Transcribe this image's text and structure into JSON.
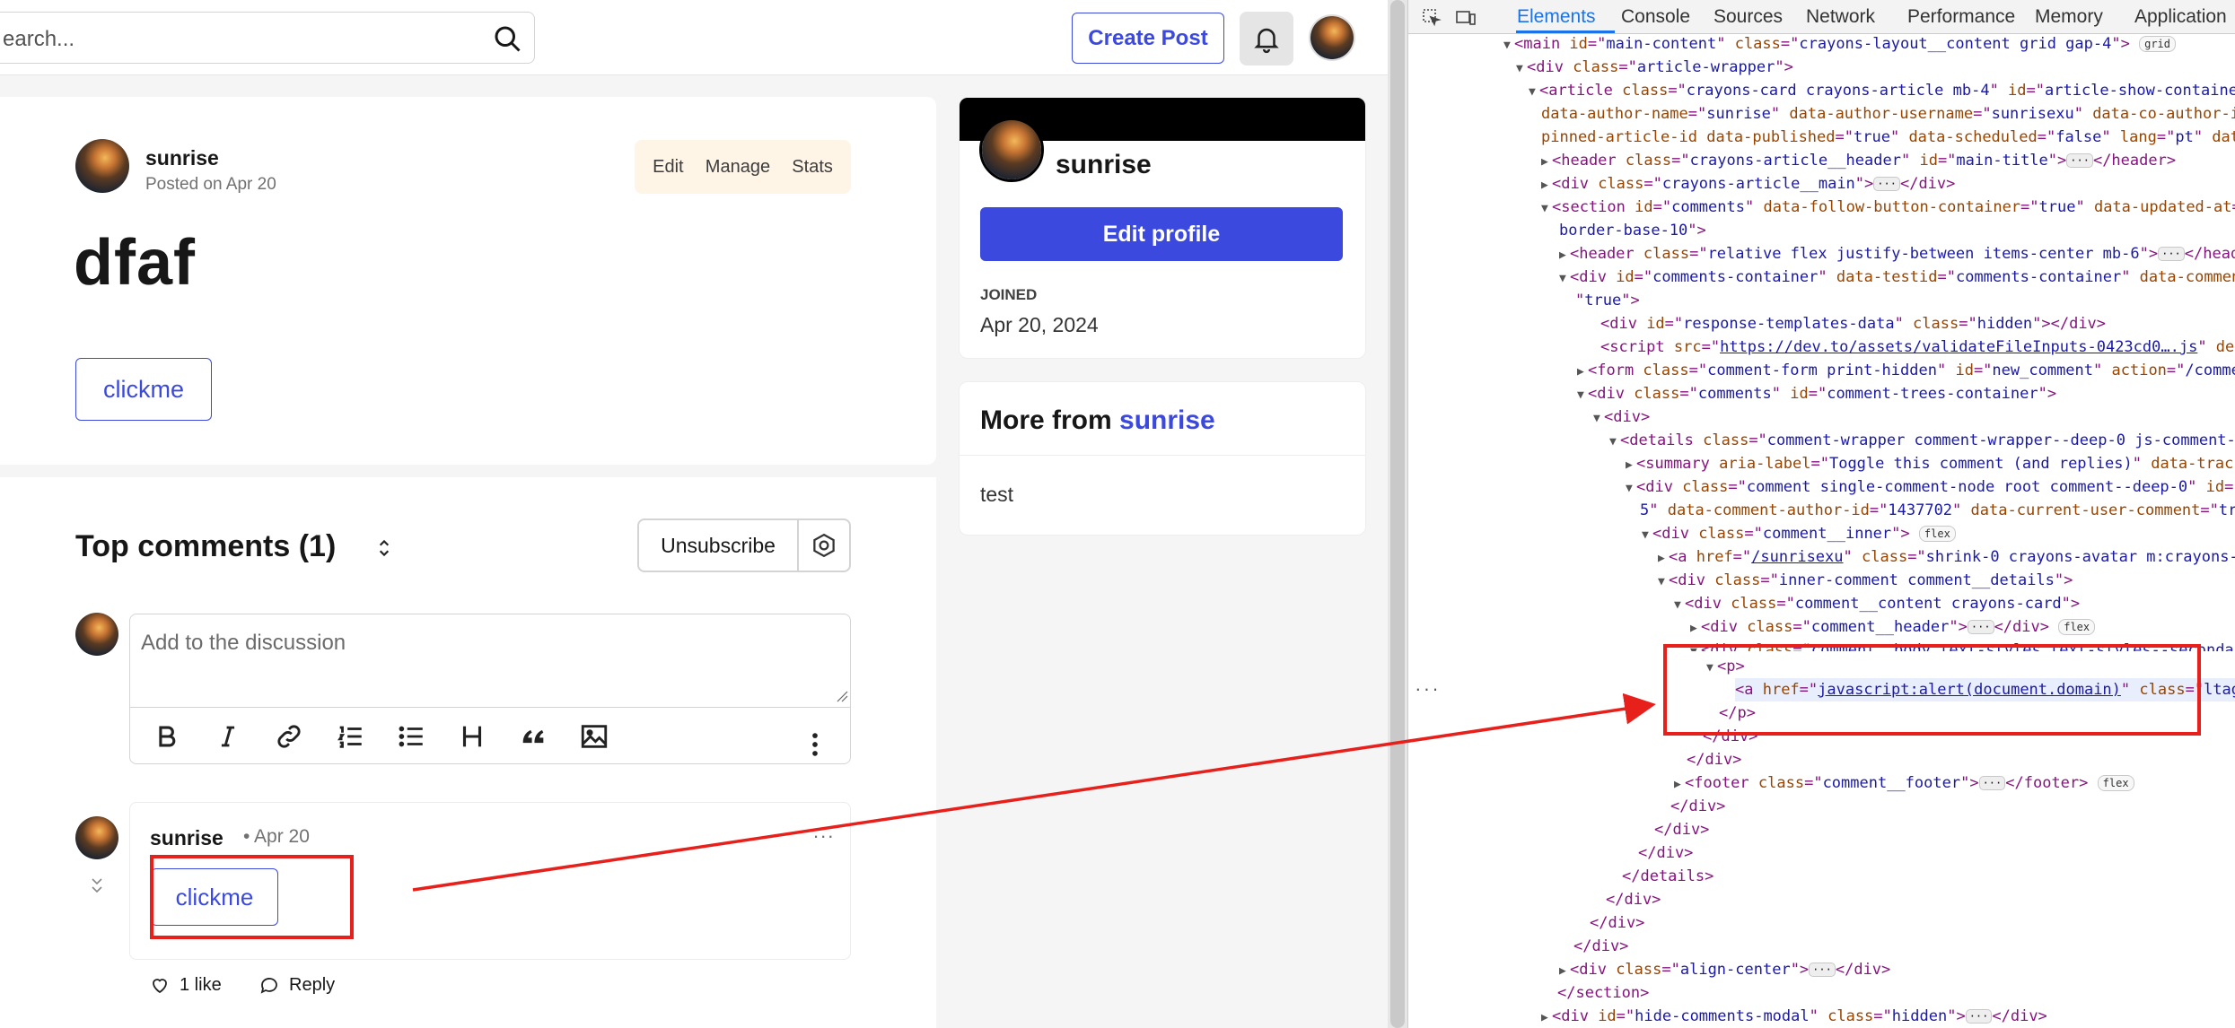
{
  "page": {
    "search": {
      "placeholder": "earch..."
    },
    "create_post": "Create Post",
    "article": {
      "author": "sunrise",
      "posted": "Posted on Apr 20",
      "actions": [
        "Edit",
        "Manage",
        "Stats"
      ],
      "title": "dfaf",
      "button": "clickme"
    },
    "comments": {
      "title": "Top comments (1)",
      "unsubscribe": "Unsubscribe",
      "input_placeholder": "Add to the discussion",
      "reply": {
        "author": "sunrise",
        "date": "Apr 20",
        "dots": "...",
        "button": "clickme",
        "likes": "1 like",
        "reply_label": "Reply"
      }
    },
    "profile": {
      "name": "sunrise",
      "edit_profile": "Edit profile",
      "joined_label": "JOINED",
      "joined_date": "Apr 20, 2024"
    },
    "more_from": {
      "prefix": "More from",
      "author": "sunrise",
      "item": "test"
    }
  },
  "devtools": {
    "tabs": [
      "Elements",
      "Console",
      "Sources",
      "Network",
      "Performance",
      "Memory",
      "Application"
    ],
    "active_tab": "Elements",
    "gutter": "..."
  },
  "colors": {
    "accent": "#3b49df",
    "highlight": "#e8201c",
    "tag": "#881280",
    "attr_name": "#994500",
    "attr_value": "#1a1aa6"
  }
}
